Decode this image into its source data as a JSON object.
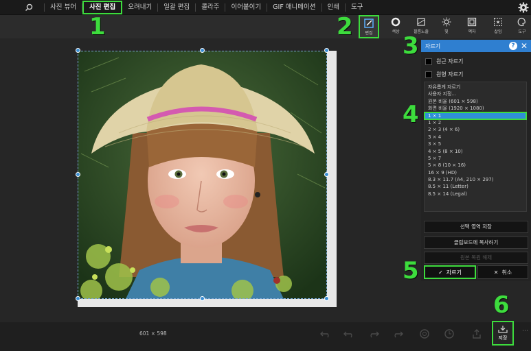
{
  "menu": {
    "items": [
      "사진 뷰어",
      "사진 편집",
      "오려내기",
      "일괄 편집",
      "콜라주",
      "이어붙이기",
      "GIF 애니메이션",
      "인쇄",
      "도구"
    ],
    "active_index": 1
  },
  "toolbar": {
    "tools": [
      {
        "label": "편집",
        "icon": "edit-icon"
      },
      {
        "label": "색상",
        "icon": "color-circle-icon"
      },
      {
        "label": "필름노출",
        "icon": "film-icon"
      },
      {
        "label": "빛",
        "icon": "light-icon"
      },
      {
        "label": "액자",
        "icon": "frame-icon"
      },
      {
        "label": "삽입",
        "icon": "insert-icon"
      },
      {
        "label": "도구",
        "icon": "tools-palette-icon"
      }
    ],
    "active_index": 0
  },
  "panel": {
    "title": "자르기",
    "options": [
      {
        "label": "원근 자르기",
        "checked": false
      },
      {
        "label": "원형 자르기",
        "checked": false
      }
    ],
    "ratios": [
      "자유롭게 자르기",
      "사용자 지정...",
      "원본 비율 (601 × 598)",
      "화면 비율 (1920 × 1080)",
      "1 × 1",
      "1 × 2",
      "2 × 3 (4 × 6)",
      "3 × 4",
      "3 × 5",
      "4 × 5 (8 × 10)",
      "5 × 7",
      "5 × 8 (10 × 16)",
      "16 × 9 (HD)",
      "8.3 × 11.7 (A4, 210 × 297)",
      "8.5 × 11 (Letter)",
      "8.5 × 14 (Legal)"
    ],
    "selected_ratio_index": 4,
    "buttons": {
      "save_selection": "선택 영역 저장",
      "copy_clipboard": "클립보드에 복사하기",
      "disabled": "원본 복원 해제"
    },
    "crop_ok": "자르기",
    "crop_cancel": "취소"
  },
  "status": {
    "dimensions": "601 × 598"
  },
  "bottom": {
    "save_label": "저장"
  },
  "annotations": [
    "1",
    "2",
    "3",
    "4",
    "5",
    "6"
  ],
  "colors": {
    "accent_green": "#3ddc3d",
    "panel_blue": "#2f7fd0",
    "selection_blue": "#2f8fd8"
  }
}
